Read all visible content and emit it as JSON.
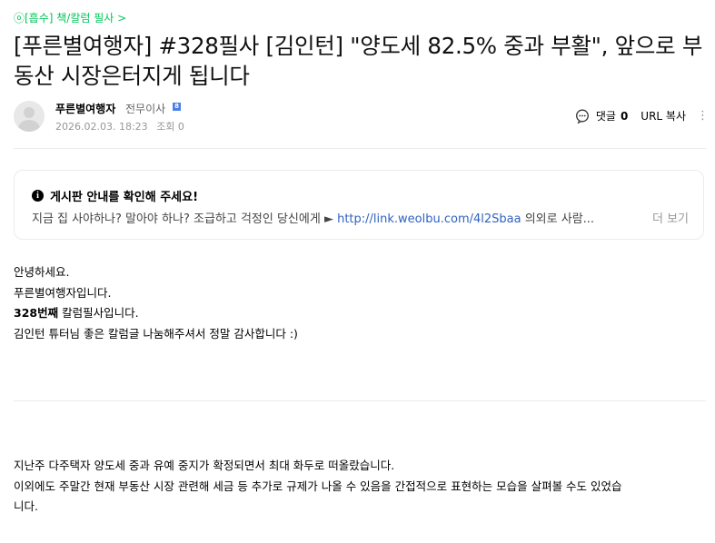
{
  "breadcrumb": "ⓞ[흡수] 책/칼럼 필사 >",
  "title": "[푸른별여행자] #328필사 [김인턴] \"양도세 82.5% 중과 부활\", 앞으로 부동산 시장은터지게 됩니다",
  "author": {
    "nickname": "푸른별여행자",
    "rank": "전무이사",
    "level_badge": "8",
    "date": "2026.02.03. 18:23",
    "views": "조회 0"
  },
  "tools": {
    "comment_label": "댓글",
    "comment_count": "0",
    "url_copy": "URL 복사",
    "more": "⋮"
  },
  "notice": {
    "heading": "게시판 안내를 확인해 주세요!",
    "text_before": "지금 집 사야하나? 말아야 하나? 조급하고 걱정인 당신에게 ► ",
    "link": "http://link.weolbu.com/4l2Sbaa",
    "text_after": " 의외로 사람...",
    "more": "더 보기"
  },
  "content": {
    "para1": [
      "안녕하세요.",
      "푸른별여행자입니다."
    ],
    "para1_bold": "328번째",
    "para1_bold_rest": " 칼럼필사입니다.",
    "para1_last": "김인턴 튜터님 좋은 칼럼글 나눔해주셔서 정말 감사합니다 :)",
    "para2": [
      "지난주 다주택자 양도세 중과 유예 중지가 확정되면서 최대 화두로 떠올랐습니다.",
      "이외에도 주말간 현재 부동산 시장 관련해 세금 등 추가로 규제가 나올 수 있음을 간접적으로 표현하는 모습을 살펴볼 수도 있었습",
      "니다."
    ]
  }
}
